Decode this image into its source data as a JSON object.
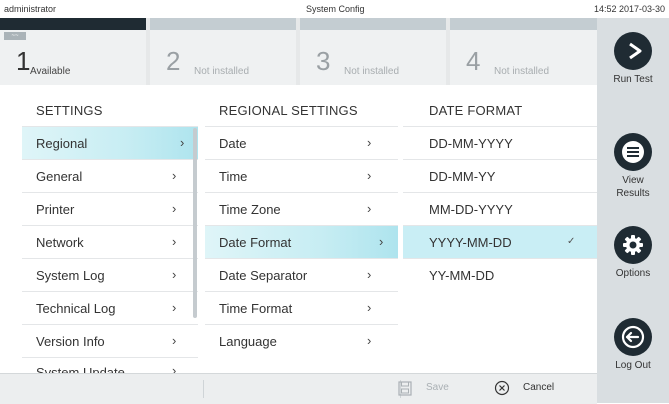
{
  "topbar": {
    "user": "administrator",
    "title": "System Config",
    "clock": "14:52 2017-03-30"
  },
  "modules": [
    {
      "number": "1",
      "label": "Available",
      "tag": "~~"
    },
    {
      "number": "2",
      "label": "Not installed"
    },
    {
      "number": "3",
      "label": "Not installed"
    },
    {
      "number": "4",
      "label": "Not installed"
    }
  ],
  "settings": {
    "header": "SETTINGS",
    "items": [
      "Regional",
      "General",
      "Printer",
      "Network",
      "System Log",
      "Technical Log",
      "Version Info",
      "System Update"
    ]
  },
  "regional": {
    "header": "REGIONAL SETTINGS",
    "items": [
      "Date",
      "Time",
      "Time Zone",
      "Date Format",
      "Date Separator",
      "Time Format",
      "Language"
    ]
  },
  "date_format": {
    "header": "DATE FORMAT",
    "items": [
      "DD-MM-YYYY",
      "DD-MM-YY",
      "MM-DD-YYYY",
      "YYYY-MM-DD",
      "YY-MM-DD"
    ],
    "selected": "YYYY-MM-DD"
  },
  "sidebar": {
    "run_test": "Run Test",
    "view_results_1": "View",
    "view_results_2": "Results",
    "options": "Options",
    "log_out": "Log Out"
  },
  "footer": {
    "save": "Save",
    "cancel": "Cancel"
  },
  "icons": {
    "chevron": "›",
    "check": "✓"
  },
  "colors": {
    "accent_dark": "#1f2b33",
    "selection": "#c7edf3"
  }
}
